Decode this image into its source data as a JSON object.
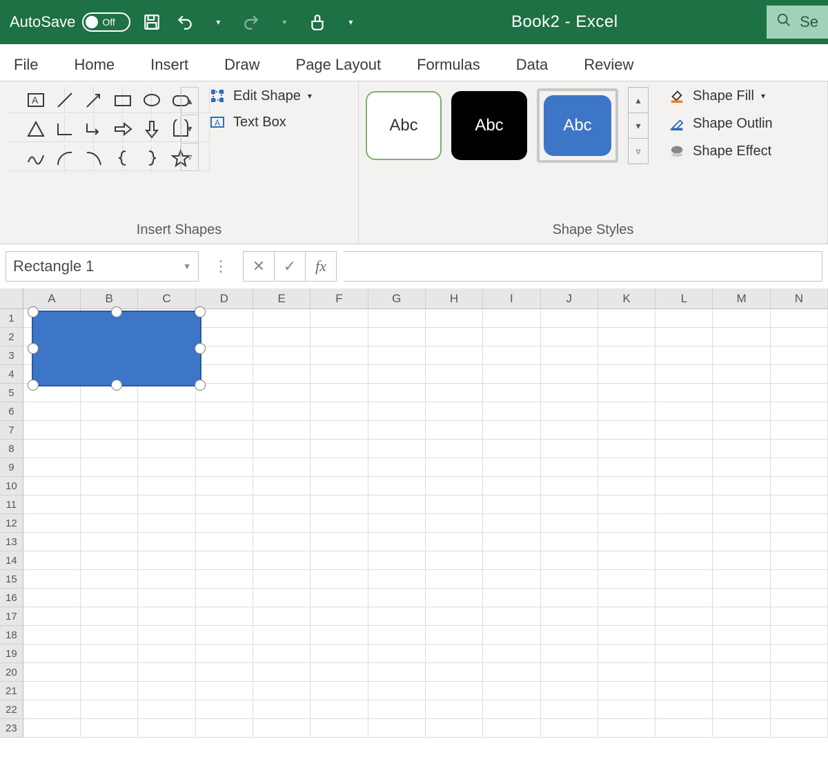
{
  "titlebar": {
    "autosave_label": "AutoSave",
    "autosave_state": "Off",
    "document_title": "Book2  -  Excel",
    "search_placeholder": "Se"
  },
  "tabs": {
    "file": "File",
    "home": "Home",
    "insert": "Insert",
    "draw": "Draw",
    "page_layout": "Page Layout",
    "formulas": "Formulas",
    "data": "Data",
    "review": "Review"
  },
  "ribbon": {
    "insert_shapes": {
      "group_label": "Insert Shapes",
      "edit_shape": "Edit Shape",
      "text_box": "Text Box"
    },
    "shape_styles": {
      "group_label": "Shape Styles",
      "swatch_text": "Abc",
      "fill": "Shape Fill",
      "outline": "Shape Outlin",
      "effects": "Shape Effect"
    }
  },
  "formula_bar": {
    "name_box": "Rectangle 1",
    "fx": "fx",
    "value": ""
  },
  "grid": {
    "columns": [
      "A",
      "B",
      "C",
      "D",
      "E",
      "F",
      "G",
      "H",
      "I",
      "J",
      "K",
      "L",
      "M",
      "N"
    ],
    "rows": [
      1,
      2,
      3,
      4,
      5,
      6,
      7,
      8,
      9,
      10,
      11,
      12,
      13,
      14,
      15,
      16,
      17,
      18,
      19,
      20,
      21,
      22,
      23
    ],
    "selected_shape_name": "Rectangle 1"
  },
  "colors": {
    "brand_green": "#1e7045",
    "shape_blue": "#3d76c7"
  }
}
